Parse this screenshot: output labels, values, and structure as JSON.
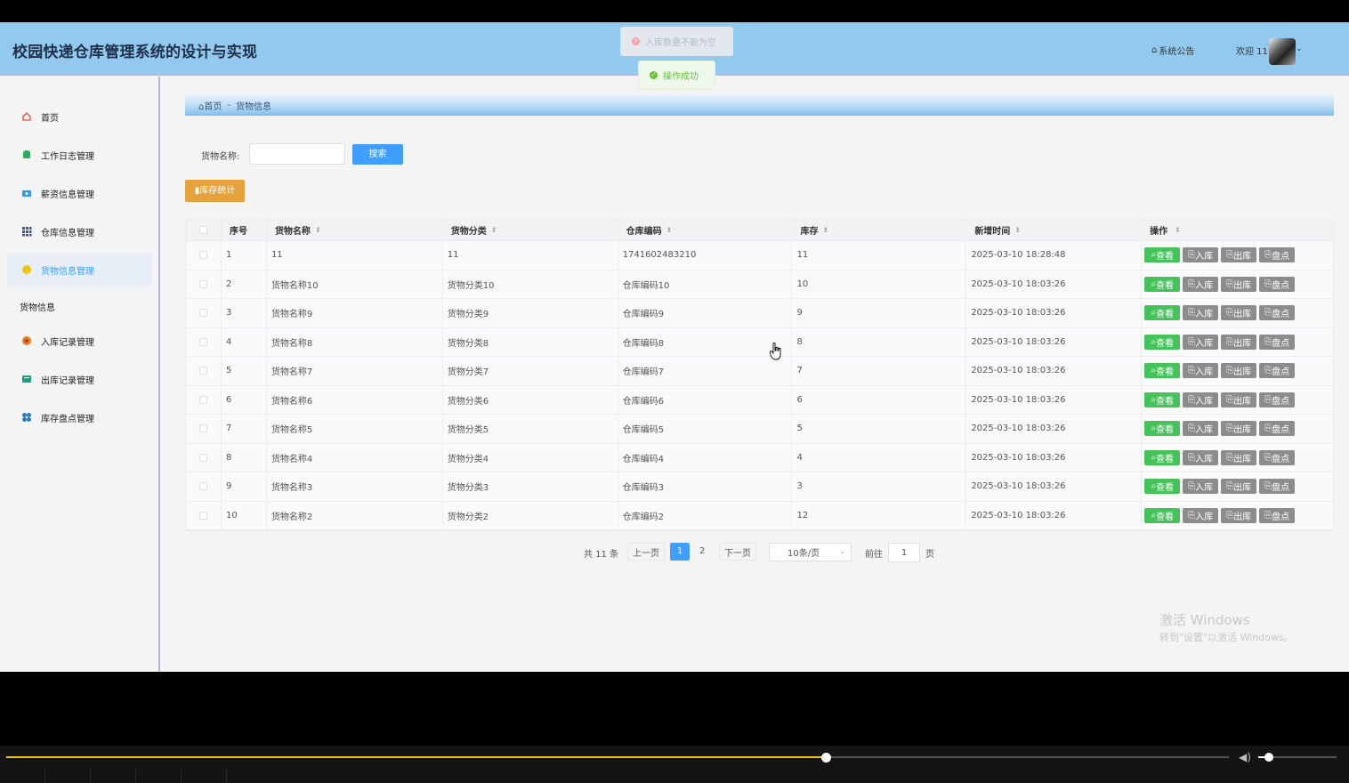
{
  "header": {
    "title": "校园快递仓库管理系统的设计与实现",
    "notice_label": "系统公告",
    "welcome": "欢迎 11"
  },
  "toasts": {
    "error": "入库数量不能为空",
    "success": "操作成功"
  },
  "sidebar": {
    "items": [
      {
        "label": "首页",
        "icon": "home-icon",
        "color": "#e74c3c"
      },
      {
        "label": "工作日志管理",
        "icon": "log-icon",
        "color": "#27ae60"
      },
      {
        "label": "薪资信息管理",
        "icon": "salary-icon",
        "color": "#3498db"
      },
      {
        "label": "仓库信息管理",
        "icon": "grid-icon",
        "color": "#3f51b5"
      },
      {
        "label": "货物信息管理",
        "icon": "goods-icon",
        "color": "#f1c40f"
      },
      {
        "label": "入库记录管理",
        "icon": "inbound-icon",
        "color": "#e67e22"
      },
      {
        "label": "出库记录管理",
        "icon": "outbound-icon",
        "color": "#16a085"
      },
      {
        "label": "库存盘点管理",
        "icon": "inventory-icon",
        "color": "#2980b9"
      }
    ],
    "group_label": "货物信息"
  },
  "breadcrumb": {
    "home": "首页",
    "separator": "-",
    "current": "货物信息"
  },
  "search": {
    "label": "货物名称:",
    "value": "",
    "button": "搜索"
  },
  "stats_button": "库存统计",
  "table": {
    "headers": [
      "序号",
      "货物名称",
      "货物分类",
      "仓库编码",
      "库存",
      "新增时间",
      "操作"
    ],
    "rows": [
      {
        "no": "1",
        "name": "11",
        "category": "11",
        "code": "1741602483210",
        "stock": "11",
        "time": "2025-03-10 18:28:48"
      },
      {
        "no": "2",
        "name": "货物名称10",
        "category": "货物分类10",
        "code": "仓库编码10",
        "stock": "10",
        "time": "2025-03-10 18:03:26"
      },
      {
        "no": "3",
        "name": "货物名称9",
        "category": "货物分类9",
        "code": "仓库编码9",
        "stock": "9",
        "time": "2025-03-10 18:03:26"
      },
      {
        "no": "4",
        "name": "货物名称8",
        "category": "货物分类8",
        "code": "仓库编码8",
        "stock": "8",
        "time": "2025-03-10 18:03:26"
      },
      {
        "no": "5",
        "name": "货物名称7",
        "category": "货物分类7",
        "code": "仓库编码7",
        "stock": "7",
        "time": "2025-03-10 18:03:26"
      },
      {
        "no": "6",
        "name": "货物名称6",
        "category": "货物分类6",
        "code": "仓库编码6",
        "stock": "6",
        "time": "2025-03-10 18:03:26"
      },
      {
        "no": "7",
        "name": "货物名称5",
        "category": "货物分类5",
        "code": "仓库编码5",
        "stock": "5",
        "time": "2025-03-10 18:03:26"
      },
      {
        "no": "8",
        "name": "货物名称4",
        "category": "货物分类4",
        "code": "仓库编码4",
        "stock": "4",
        "time": "2025-03-10 18:03:26"
      },
      {
        "no": "9",
        "name": "货物名称3",
        "category": "货物分类3",
        "code": "仓库编码3",
        "stock": "3",
        "time": "2025-03-10 18:03:26"
      },
      {
        "no": "10",
        "name": "货物名称2",
        "category": "货物分类2",
        "code": "仓库编码2",
        "stock": "12",
        "time": "2025-03-10 18:03:26"
      }
    ],
    "actions": [
      "查看",
      "入库",
      "出库",
      "盘点"
    ]
  },
  "pagination": {
    "total": "共 11 条",
    "prev": "上一页",
    "pages": [
      "1",
      "2"
    ],
    "current": "1",
    "next": "下一页",
    "page_size": "10条/页",
    "goto_label": "前往",
    "goto_value": "1",
    "page_suffix": "页"
  },
  "watermark": {
    "line1": "激活 Windows",
    "line2": "转到\"设置\"以激活 Windows。"
  },
  "player": {
    "progress": 0.67,
    "volume": 0.1
  }
}
